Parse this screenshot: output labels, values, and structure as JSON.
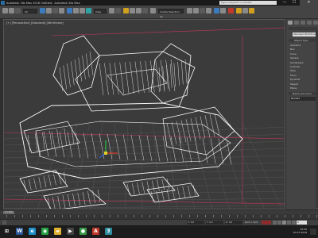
{
  "titlebar": {
    "title": "Autodesk 3ds Max 2018   Untitled - Autodesk 3ds Max",
    "search_placeholder": "Type a keyword or phrase",
    "minimize": "—",
    "maximize": "☐",
    "close": "✕"
  },
  "toolbar": {
    "selection_filter": "All",
    "reference_coord": "View",
    "named_selection": "Create Selection Se"
  },
  "viewport": {
    "label": "[+] [Perspective] [Standard] [Wireframe]",
    "wire_color": "#ffffff",
    "grid_color": "#5a5a5a",
    "redline_color": "#c0395a"
  },
  "command_panel": {
    "tabs": [
      "create-tab",
      "modify-tab",
      "hierarchy-tab",
      "motion-tab",
      "display-tab",
      "utilities-tab"
    ],
    "object_type_header": "Object Type",
    "items": [
      "AutoGrid",
      "Box",
      "Cone",
      "Sphere",
      "GeoSphere",
      "Cylinder",
      "Tube",
      "Torus",
      "Pyramid",
      "Teapot",
      "Plane"
    ],
    "name_field": "Standard Primitives",
    "name_color_header": "Name and Color",
    "object_name": "Box001"
  },
  "timeslider": {
    "position": "0 / 100"
  },
  "statusbar": {
    "x_value": "X: 0.0",
    "y_value": "Y: 0.0",
    "z_value": "Z: 0.0",
    "grid": "Grid = 10.0",
    "add_time_tag": "Add Time Tag",
    "frame": "0"
  },
  "taskbar": {
    "apps": [
      {
        "name": "start-icon",
        "glyph": "⊞",
        "color": "#1c1c1c"
      },
      {
        "name": "word-icon",
        "glyph": "W",
        "color": "#2b579a"
      },
      {
        "name": "ie-icon",
        "glyph": "e",
        "color": "#1e90c8"
      },
      {
        "name": "whatsapp-icon",
        "glyph": "◉",
        "color": "#25a244"
      },
      {
        "name": "folder-icon",
        "glyph": "▰",
        "color": "#e0b030"
      },
      {
        "name": "media-icon",
        "glyph": "▶",
        "color": "#444444"
      },
      {
        "name": "chrome-icon",
        "glyph": "●",
        "color": "#3a9a4a"
      },
      {
        "name": "autodesk-icon",
        "glyph": "A",
        "color": "#c0392b"
      },
      {
        "name": "3dsmax-icon",
        "glyph": "3",
        "color": "#2f8f9f"
      }
    ],
    "time": "12:45",
    "date": "10-07-2018"
  }
}
